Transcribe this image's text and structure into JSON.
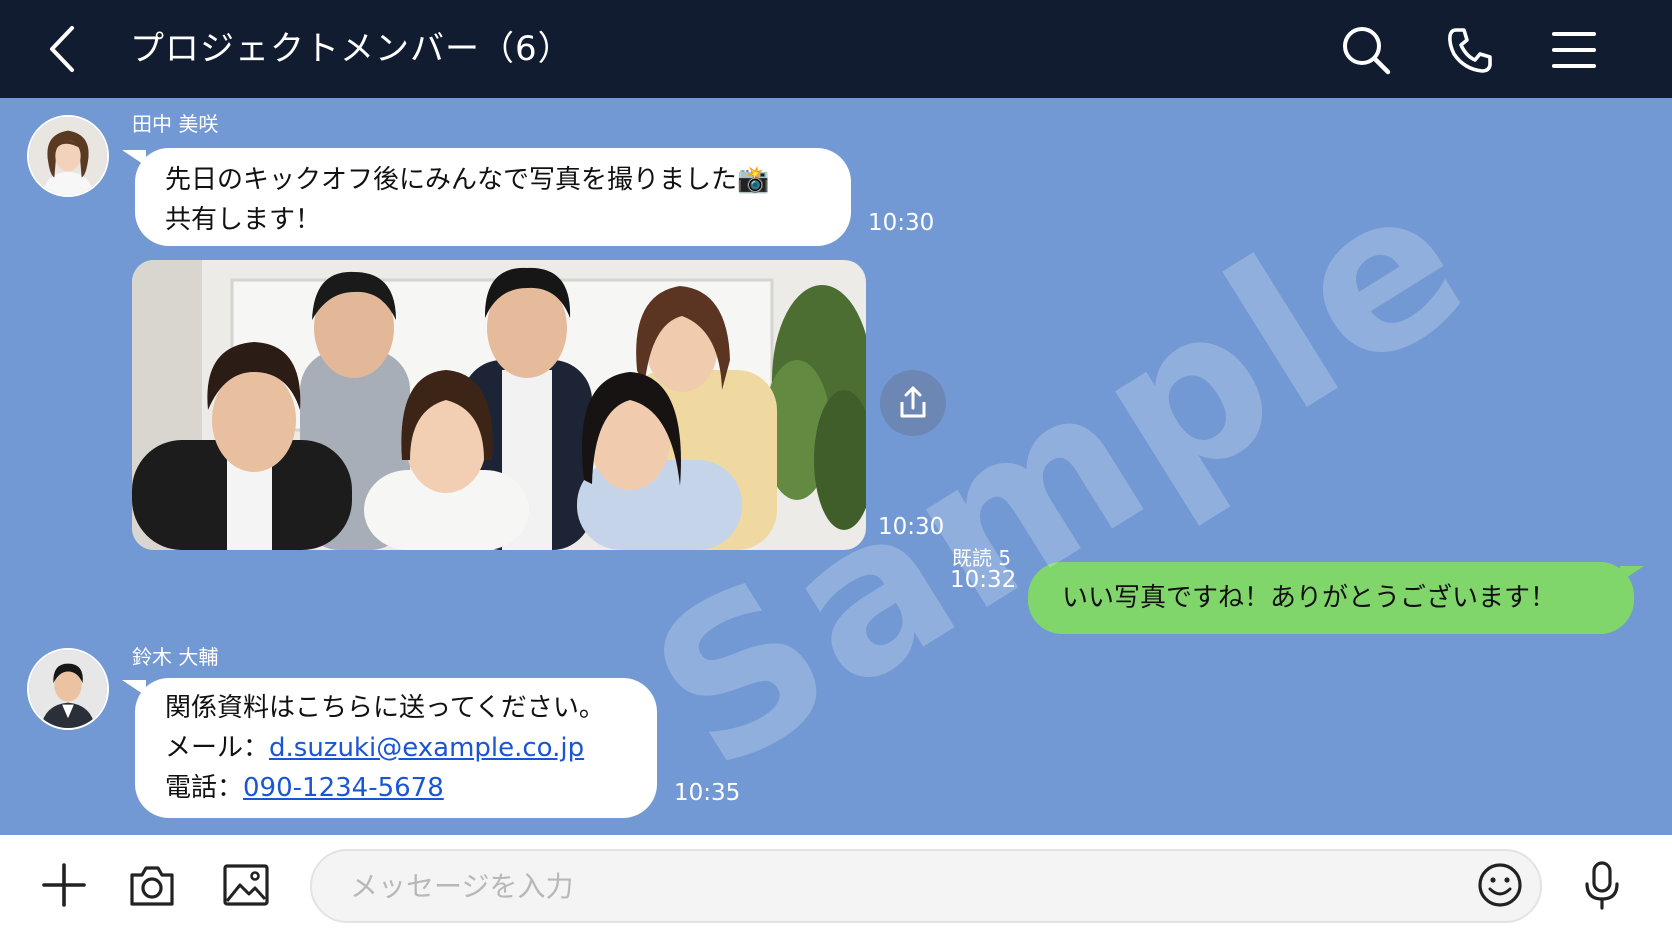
{
  "header": {
    "title": "プロジェクトメンバー（6）",
    "back_icon": "chevron-left-icon",
    "search_icon": "search-icon",
    "call_icon": "phone-icon",
    "menu_icon": "menu-icon",
    "background": "#121c30"
  },
  "chat": {
    "background": "#7399d4",
    "messages": [
      {
        "sender": "田中 美咲",
        "line1": "先日のキックオフ後にみんなで写真を撮りました📸",
        "line2": "共有します！",
        "time": "10:30"
      },
      {
        "type": "photo",
        "time": "10:30",
        "share_icon": "share-icon"
      },
      {
        "outgoing": true,
        "text": "いい写真ですね！ありがとうございます！",
        "read_status": "既読 5",
        "time": "10:32",
        "bubble_color": "#80d66b"
      },
      {
        "sender": "鈴木 大輔",
        "line1": "関係資料はこちらに送ってください。",
        "email_label": "メール：",
        "email": "d.suzuki@example.co.jp",
        "phone_label": "電話：",
        "phone": "090-1234-5678",
        "time": "10:35"
      }
    ],
    "watermark": "Sample"
  },
  "composer": {
    "placeholder": "メッセージを入力",
    "add_icon": "plus-icon",
    "camera_icon": "camera-icon",
    "image_icon": "image-icon",
    "emoji_icon": "emoji-icon",
    "mic_icon": "microphone-icon"
  }
}
